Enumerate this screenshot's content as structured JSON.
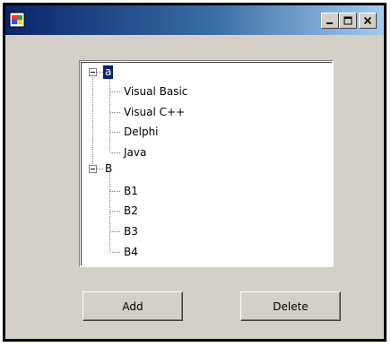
{
  "window": {
    "title": "",
    "icon": "app-window-icon",
    "controls": [
      "minimize-icon",
      "maximize-icon",
      "close-icon"
    ]
  },
  "tree": {
    "nodes": [
      {
        "label": "a",
        "expanded": true,
        "selected": true,
        "children": [
          "Visual Basic",
          "Visual C++",
          "Delphi",
          "Java"
        ]
      },
      {
        "label": "B",
        "expanded": true,
        "selected": false,
        "children": [
          "B1",
          "B2",
          "B3",
          "B4"
        ]
      }
    ]
  },
  "buttons": {
    "add_label": "Add",
    "delete_label": "Delete"
  },
  "colors": {
    "titlebar_start": "#0a246a",
    "titlebar_end": "#a6caf0",
    "window_bg": "#d4d0c8",
    "selection_bg": "#0a246a"
  }
}
